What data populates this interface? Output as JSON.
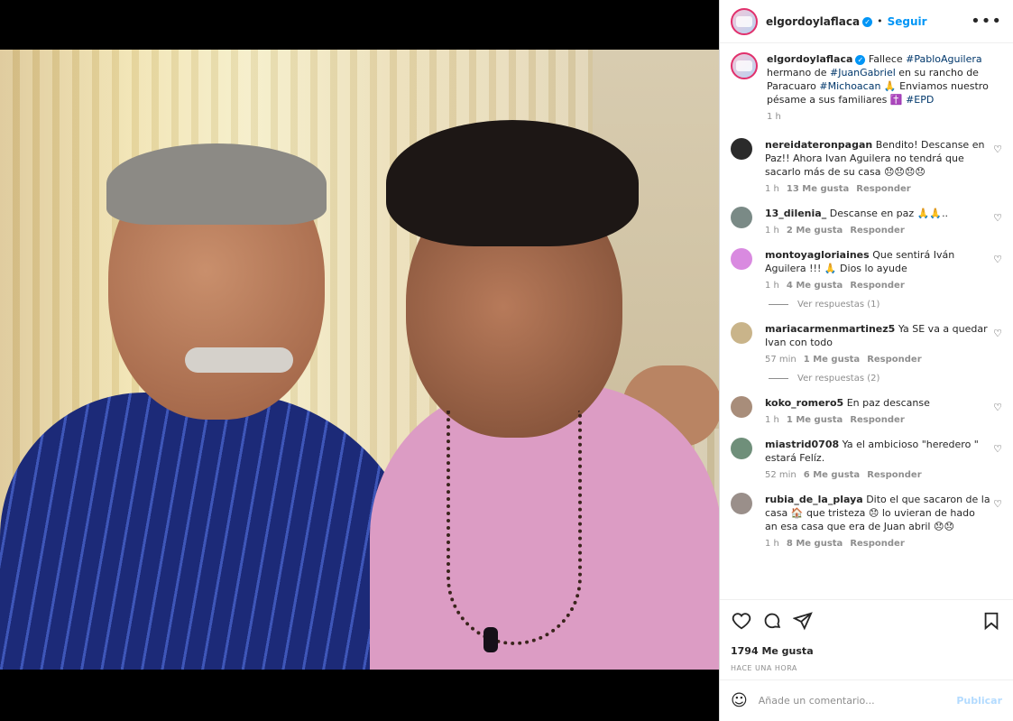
{
  "header": {
    "username": "elgordoylaflaca",
    "verified_mark": "✓",
    "separator": "•",
    "follow_label": "Seguir",
    "more_icon": "more-horizontal-icon"
  },
  "caption": {
    "username": "elgordoylaflaca",
    "text_1": " Fallece ",
    "tag_1": "#PabloAguilera",
    "text_2": " hermano de ",
    "tag_2": "#JuanGabriel",
    "text_3": " en su rancho de Paracuaro ",
    "tag_3": "#Michoacan",
    "text_4": " 🙏 Enviamos nuestro pésame a sus familiares ✝️ ",
    "tag_4": "#EPD",
    "time": "1 h"
  },
  "comments": [
    {
      "user": "nereidateronpagan",
      "text": "Bendito! Descanse en Paz!! Ahora Ivan Aguilera no tendrá que sacarlo más de su casa 😞😞😞😞",
      "time": "1 h",
      "likes": "13 Me gusta",
      "reply": "Responder",
      "avatar_color": "#2b2b2b"
    },
    {
      "user": "13_dilenia_",
      "text": "Descanse en paz 🙏🙏..",
      "time": "1 h",
      "likes": "2 Me gusta",
      "reply": "Responder",
      "avatar_color": "#7a8a86"
    },
    {
      "user": "montoyagloriaines",
      "text": "Que sentirá Iván Aguilera !!! 🙏 Dios lo ayude",
      "time": "1 h",
      "likes": "4 Me gusta",
      "reply": "Responder",
      "avatar_color": "#d98ae0",
      "replies": "Ver respuestas (1)"
    },
    {
      "user": "mariacarmenmartinez5",
      "text": "Ya SE va a quedar Ivan con todo",
      "time": "57 min",
      "likes": "1 Me gusta",
      "reply": "Responder",
      "avatar_color": "#c9b48a",
      "replies": "Ver respuestas (2)"
    },
    {
      "user": "koko_romero5",
      "text": "En paz descanse",
      "time": "1 h",
      "likes": "1 Me gusta",
      "reply": "Responder",
      "avatar_color": "#a88d7a"
    },
    {
      "user": "miastrid0708",
      "text": "Ya el ambicioso \"heredero \" estará Felíz.",
      "time": "52 min",
      "likes": "6 Me gusta",
      "reply": "Responder",
      "avatar_color": "#6f8f7a"
    },
    {
      "user": "rubia_de_la_playa",
      "text": "Dito el que sacaron de la casa 🏠 que tristeza 😞 lo uvieran de hado an esa casa que era de Juan abril 😞😞",
      "time": "1 h",
      "likes": "8 Me gusta",
      "reply": "Responder",
      "avatar_color": "#9a8f8a"
    }
  ],
  "actions": {
    "likes": "1794 Me gusta",
    "ago": "HACE UNA HORA",
    "comment_placeholder": "Añade un comentario...",
    "publish_label": "Publicar"
  },
  "colors": {
    "accent": "#0095f6",
    "link": "#00376b",
    "muted": "#8e8e8e"
  }
}
